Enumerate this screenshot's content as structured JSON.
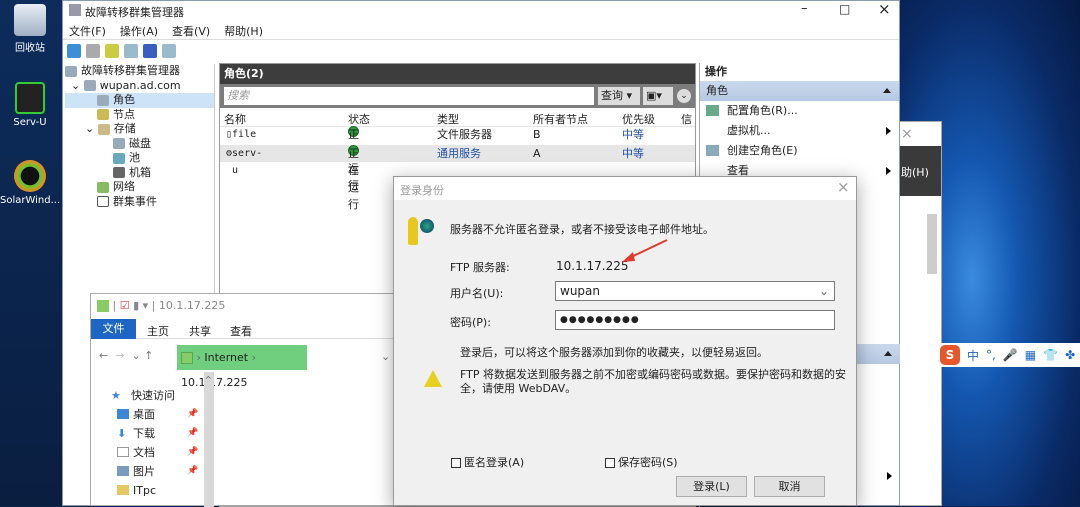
{
  "desktop": {
    "icons": [
      {
        "label": "回收站"
      },
      {
        "label": "Serv-U"
      },
      {
        "label": "SolarWind..."
      }
    ]
  },
  "mmc": {
    "title": "故障转移群集管理器",
    "menu": [
      "文件(F)",
      "操作(A)",
      "查看(V)",
      "帮助(H)"
    ],
    "tree": {
      "root": "故障转移群集管理器",
      "cluster": "wupan.ad.com",
      "items": [
        "角色",
        "节点",
        "存储",
        "磁盘",
        "池",
        "机箱",
        "网络",
        "群集事件"
      ]
    },
    "roles": {
      "header": "角色(2)",
      "search_placeholder": "搜索",
      "query_label": "查询",
      "columns": [
        "名称",
        "状态",
        "类型",
        "所有者节点",
        "优先级",
        "信"
      ],
      "rows": [
        {
          "name": "file",
          "status": "正在运行",
          "type": "文件服务器",
          "owner": "B",
          "priority": "中等"
        },
        {
          "name": "serv-u",
          "status": "正在运行",
          "type": "通用服务",
          "owner": "A",
          "priority": "中等"
        }
      ]
    },
    "actions": {
      "header": "操作",
      "section": "角色",
      "items": [
        "配置角色(R)...",
        "虚拟机...",
        "创建空角色(E)",
        "查看"
      ]
    }
  },
  "back_window": {
    "menu_fragment": "助(H)"
  },
  "ime": {
    "items": [
      "中",
      "°,",
      "🎤",
      "▦",
      "👕",
      "✤"
    ]
  },
  "explorer": {
    "title": "10.1.17.225",
    "tabs": [
      "文件",
      "主页",
      "共享",
      "查看"
    ],
    "path": [
      "Internet",
      "10.1.17.225"
    ],
    "nav": {
      "quick_access": "快速访问",
      "items": [
        "桌面",
        "下载",
        "文档",
        "图片",
        "ITpc"
      ]
    }
  },
  "dialog": {
    "title": "登录身份",
    "message": "服务器不允许匿名登录，或者不接受该电子邮件地址。",
    "server_label": "FTP 服务器:",
    "server_value": "10.1.17.225",
    "username_label": "用户名(U):",
    "username_value": "wupan",
    "password_label": "密码(P):",
    "password_value": "●●●●●●●●●",
    "info": "登录后，可以将这个服务器添加到你的收藏夹，以便轻易返回。",
    "warning": "FTP 将数据发送到服务器之前不加密或编码密码或数据。要保护密码和数据的安全，请使用 WebDAV。",
    "anonymous_label": "匿名登录(A)",
    "save_password_label": "保存密码(S)",
    "login_button": "登录(L)",
    "cancel_button": "取消"
  },
  "colors": {
    "accent": "#1e66c4",
    "annotation_arrow": "#e23b2e"
  }
}
